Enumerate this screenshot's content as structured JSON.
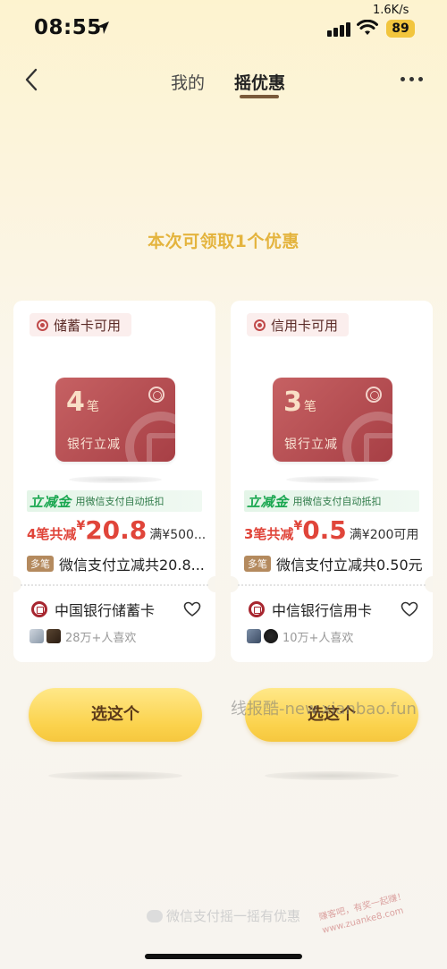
{
  "status_bar": {
    "time": "08:55",
    "net_speed": "1.6K/s",
    "battery": "89"
  },
  "nav": {
    "tabs": [
      {
        "label": "我的"
      },
      {
        "label": "摇优惠"
      }
    ],
    "active_tab": "摇优惠"
  },
  "claim_title": "本次可领取1个优惠",
  "coupons": [
    {
      "tag": "储蓄卡可用",
      "card_count": "4",
      "card_count_unit": "笔",
      "card_label": "银行立减",
      "promo_title": "立减金",
      "promo_subtitle": "用微信支付自动抵扣",
      "discount_prefix": "4笔共减",
      "currency": "¥",
      "amount": "20.8",
      "condition": "满¥500...",
      "badge": "多笔",
      "description": "微信支付立减共20.8...",
      "bank_name": "中国银行储蓄卡",
      "likes": "28万+人喜欢"
    },
    {
      "tag": "信用卡可用",
      "card_count": "3",
      "card_count_unit": "笔",
      "card_label": "银行立减",
      "promo_title": "立减金",
      "promo_subtitle": "用微信支付自动抵扣",
      "discount_prefix": "3笔共减",
      "currency": "¥",
      "amount": "0.5",
      "condition": "满¥200可用",
      "badge": "多笔",
      "description": "微信支付立减共0.50元",
      "bank_name": "中信银行信用卡",
      "likes": "10万+人喜欢"
    }
  ],
  "choose_label": "选这个",
  "watermark": "线报酷-new.xianbao.fun",
  "footer": "微信支付摇一摇有优惠",
  "stamp": {
    "line1": "赚客吧，有奖一起赚！",
    "line2": "www.zuanke8.com"
  },
  "colors": {
    "accent_gold": "#e4b43e",
    "discount_red": "#e0453a",
    "promo_green": "#1aa750",
    "card_red": "#b44a4f",
    "button_yellow": "#fbd24c"
  }
}
